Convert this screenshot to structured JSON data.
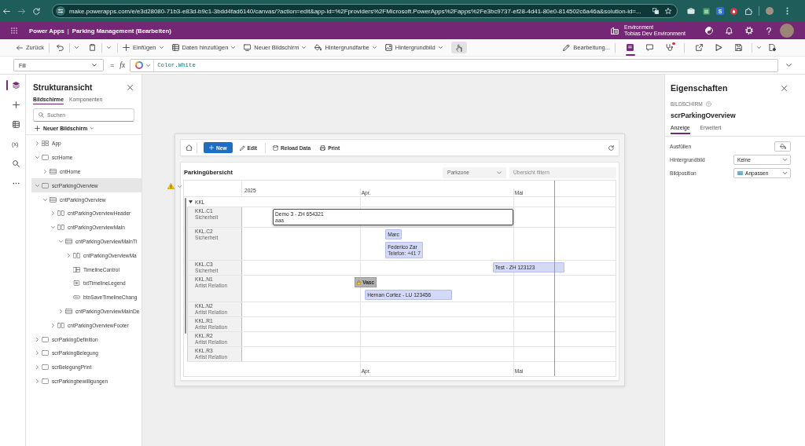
{
  "browser": {
    "url": "make.powerapps.com/e/e3d28080-71b3-e83d-b9c1-3bdd4fad6140/canvas/?action=edit&app-id=%2Fproviders%2FMicrosoft.PowerApps%2Fapps%2Fe3bc9737-ef28-4d41-80e0-814502c6a46a&solution-id=...",
    "extension_letter": "S"
  },
  "header": {
    "product": "Power Apps",
    "separator": "|",
    "app_title": "Parking Management (Bearbeiten)",
    "environment_caption": "Environment",
    "environment": "Tobias Dev Environment"
  },
  "command_bar": {
    "left": [
      {
        "kind": "back",
        "label": "Zurück"
      },
      {
        "kind": "split"
      },
      {
        "kind": "split"
      },
      {
        "kind": "menu",
        "label": "Einfügen"
      },
      {
        "kind": "menu",
        "label": "Daten hinzufügen"
      },
      {
        "kind": "menu",
        "label": "Neuer Bildschirm"
      },
      {
        "kind": "menu",
        "label": "Hintergrundfarbe"
      },
      {
        "kind": "menu",
        "label": "Hintergrundbild"
      },
      {
        "kind": "more",
        "hovered": true
      }
    ],
    "edit_mode": "Bearbeitung...",
    "tools": [
      {
        "selected": true,
        "alert": false,
        "dropdown": false
      },
      {
        "selected": false,
        "alert": false,
        "dropdown": false
      },
      {
        "selected": false,
        "alert": true,
        "dropdown": false
      },
      {
        "selected": false,
        "alert": false,
        "dropdown": false
      },
      {
        "selected": false,
        "alert": false,
        "dropdown": false
      },
      {
        "selected": false,
        "alert": false,
        "dropdown": true
      },
      {
        "selected": false,
        "alert": false,
        "dropdown": false
      }
    ]
  },
  "formula_bar": {
    "property": "Fill",
    "equals": "=",
    "fx": "fx",
    "formula": "Color.White"
  },
  "rail": [
    {
      "kind": "icon",
      "selected": true
    },
    {
      "kind": "icon",
      "selected": false
    },
    {
      "kind": "icon",
      "selected": false
    },
    {
      "kind": "glyph",
      "glyph": "(x)",
      "selected": false
    },
    {
      "kind": "icon",
      "selected": false
    },
    {
      "kind": "icon",
      "selected": false
    }
  ],
  "tree_panel": {
    "title": "Strukturansicht",
    "tabs": [
      {
        "label": "Bildschirme",
        "selected": true
      },
      {
        "label": "Komponenten",
        "selected": false
      }
    ],
    "search": {
      "placeholder": "Suchen"
    },
    "new_screen": "Neuer Bildschirm",
    "items": [
      {
        "label": "App",
        "kind": "app",
        "expanded": false,
        "selected": false
      },
      {
        "label": "scrHome",
        "kind": "screen",
        "expanded": true,
        "selected": false,
        "children": [
          {
            "label": "cntHome",
            "kind": "vstack",
            "expanded": false,
            "selected": false
          }
        ]
      },
      {
        "label": "scrParkingOverview",
        "kind": "screen",
        "expanded": true,
        "selected": true,
        "children": [
          {
            "label": "cntParkingOverview",
            "kind": "vstack",
            "expanded": true,
            "selected": false,
            "children": [
              {
                "label": "cntParkingOverviewHeader",
                "kind": "hstack",
                "expanded": false,
                "selected": false
              },
              {
                "label": "cntParkingOverviewMain",
                "kind": "hstack",
                "expanded": true,
                "selected": false,
                "children": [
                  {
                    "label": "cntParkingOverviewMainTi",
                    "kind": "vstack",
                    "expanded": true,
                    "selected": false,
                    "children": [
                      {
                        "label": "cntParkingOverviewMa",
                        "kind": "hstack",
                        "expanded": false,
                        "selected": false
                      },
                      {
                        "label": "TimelineControl",
                        "kind": "component",
                        "selected": false
                      },
                      {
                        "label": "txtTimelineLegend",
                        "kind": "text",
                        "selected": false
                      },
                      {
                        "label": "btnSaveTimelineChang",
                        "kind": "button",
                        "selected": false
                      }
                    ]
                  },
                  {
                    "label": "cntParkingOverviewMainDe",
                    "kind": "vstack",
                    "expanded": false,
                    "selected": false
                  }
                ]
              },
              {
                "label": "cntParkingOverviewFooter",
                "kind": "hstack",
                "expanded": false,
                "selected": false
              }
            ]
          }
        ]
      },
      {
        "label": "scrParkingDefinition",
        "kind": "screen",
        "expanded": false,
        "selected": false
      },
      {
        "label": "scrParkingBelegung",
        "kind": "screen",
        "expanded": false,
        "selected": false
      },
      {
        "label": "scrBelegungPrint",
        "kind": "screen",
        "expanded": false,
        "selected": false
      },
      {
        "label": "scrParkingbewilligungen",
        "kind": "screen",
        "expanded": false,
        "selected": false
      }
    ]
  },
  "canvas": {
    "warning": true,
    "toolbar": [
      {
        "kind": "primary",
        "label": "New"
      },
      {
        "kind": "secondary",
        "label": "Edit"
      },
      {
        "kind": "secondary",
        "label": "Reload Data"
      },
      {
        "kind": "secondary",
        "label": "Print"
      }
    ],
    "title": "Parkingübersicht",
    "zone_dropdown": {
      "placeholder": "Parkzone"
    },
    "filter": {
      "placeholder": "Übersicht filtern"
    },
    "timeline": {
      "year": "2025",
      "months": [
        {
          "label": "Apr."
        },
        {
          "label": "Mai"
        }
      ],
      "footer_months": [
        {
          "label": "Apr."
        },
        {
          "label": "Mai"
        }
      ],
      "group": {
        "label": "KKL",
        "expanded": true
      },
      "resources": [
        {
          "name": "KKL.C1",
          "role": "Sicherheit",
          "events": [
            {
              "kind": "outlined",
              "title": "Demo 3 - ZH 654321",
              "subtitle": "aaa"
            }
          ]
        },
        {
          "name": "KKL.C2",
          "role": "Sicherheit",
          "events": [
            {
              "kind": "booking",
              "title": "Marc"
            },
            {
              "kind": "booking",
              "title": "Federico Zar",
              "subtitle": "Telefon: +41 7"
            }
          ]
        },
        {
          "name": "KKL.C3",
          "role": "Sicherheit",
          "events": [
            {
              "kind": "booking",
              "title": "Test - ZH 123123"
            }
          ]
        },
        {
          "name": "KKL.N1",
          "role": "Artist Relation",
          "events": [
            {
              "kind": "note",
              "title": "Vasc"
            },
            {
              "kind": "booking",
              "title": "Hernan Cortez - LU 123456"
            }
          ]
        },
        {
          "name": "KKL.N2",
          "role": "Artist Relation"
        },
        {
          "name": "KKL.R1",
          "role": "Artist Relation"
        },
        {
          "name": "KKL.R2",
          "role": "Artist Relation"
        },
        {
          "name": "KKL.R3",
          "role": "Artist Relation"
        }
      ]
    }
  },
  "properties": {
    "title": "Eigenschaften",
    "type_label": "BILDSCHIRM",
    "name": "scrParkingOverview",
    "tabs": [
      {
        "label": "Anzeige",
        "selected": true
      },
      {
        "label": "Erweitert",
        "selected": false
      }
    ],
    "rows": [
      {
        "kind": "color",
        "label": "Ausfüllen"
      },
      {
        "kind": "dropdown",
        "label": "Hintergrundbild",
        "value": "Keine"
      },
      {
        "kind": "image-dropdown",
        "label": "Bildposition",
        "value": "Anpassen"
      }
    ]
  }
}
